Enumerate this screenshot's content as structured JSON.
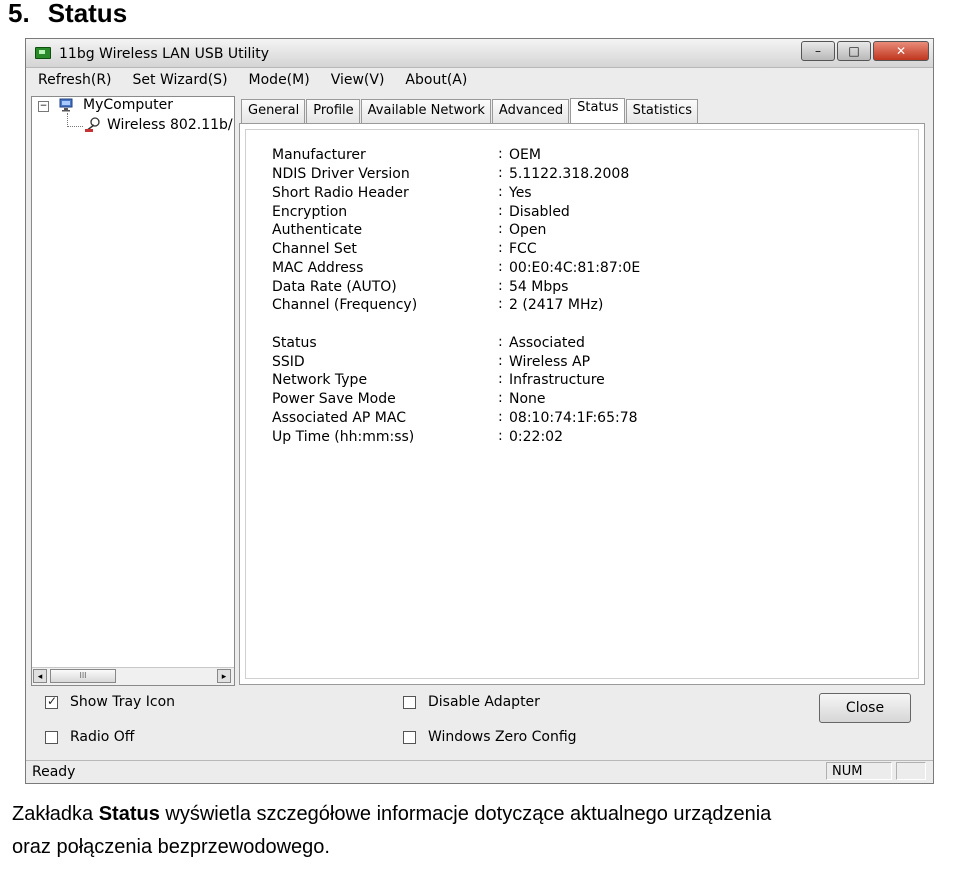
{
  "doc": {
    "heading_number": "5.",
    "heading_title": "Status",
    "caption_prefix": "Zakładka ",
    "caption_bold": "Status",
    "caption_line1_rest": " wyświetla szczegółowe informacje dotyczące aktualnego urządzenia",
    "caption_line2": "oraz połączenia bezprzewodowego."
  },
  "window": {
    "title": "11bg Wireless LAN USB Utility",
    "buttons": {
      "minimize": "–",
      "maximize": "□",
      "close": "✕"
    }
  },
  "menu": [
    {
      "label": "Refresh(R)"
    },
    {
      "label": "Set Wizard(S)"
    },
    {
      "label": "Mode(M)"
    },
    {
      "label": "View(V)"
    },
    {
      "label": "About(A)"
    }
  ],
  "tree": {
    "expander": "−",
    "root": "MyComputer",
    "child": "Wireless 802.11b/"
  },
  "tabs": [
    {
      "label": "General"
    },
    {
      "label": "Profile"
    },
    {
      "label": "Available Network"
    },
    {
      "label": "Advanced"
    },
    {
      "label": "Status",
      "active": true
    },
    {
      "label": "Statistics"
    }
  ],
  "status": {
    "colon": ":",
    "device": [
      {
        "label": "Manufacturer",
        "value": "OEM"
      },
      {
        "label": "NDIS Driver Version",
        "value": "5.1122.318.2008"
      },
      {
        "label": "Short Radio Header",
        "value": "Yes"
      },
      {
        "label": "Encryption",
        "value": "Disabled"
      },
      {
        "label": "Authenticate",
        "value": "Open"
      },
      {
        "label": "Channel Set",
        "value": "FCC"
      },
      {
        "label": "MAC Address",
        "value": "00:E0:4C:81:87:0E"
      },
      {
        "label": "Data Rate (AUTO)",
        "value": "54 Mbps"
      },
      {
        "label": "Channel (Frequency)",
        "value": "2 (2417 MHz)"
      }
    ],
    "connection": [
      {
        "label": "Status",
        "value": "Associated"
      },
      {
        "label": "SSID",
        "value": "Wireless AP"
      },
      {
        "label": "Network Type",
        "value": "Infrastructure"
      },
      {
        "label": "Power Save Mode",
        "value": "None"
      },
      {
        "label": "Associated AP MAC",
        "value": "08:10:74:1F:65:78"
      },
      {
        "label": "Up Time (hh:mm:ss)",
        "value": "0:22:02"
      }
    ]
  },
  "options": {
    "show_tray_icon": {
      "label": "Show Tray Icon",
      "checked": true
    },
    "radio_off": {
      "label": "Radio Off",
      "checked": false
    },
    "disable_adapter": {
      "label": "Disable Adapter",
      "checked": false
    },
    "windows_zero_config": {
      "label": "Windows Zero Config",
      "checked": false
    }
  },
  "close_button": "Close",
  "statusbar": {
    "text": "Ready",
    "num": "NUM"
  },
  "scrollbar": {
    "left": "◂",
    "right": "▸",
    "grip": "III"
  }
}
